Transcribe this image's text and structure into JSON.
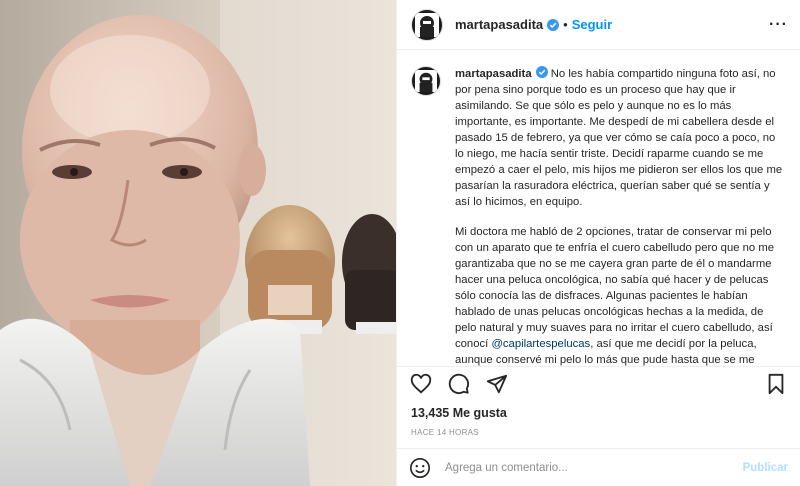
{
  "post": {
    "username": "martapasadita",
    "follow_label": "Seguir",
    "more_icon": "more-options-icon",
    "caption": {
      "p1": "No les había compartido ninguna foto así, no por pena sino porque todo es un proceso que hay que ir asimilando. Se que sólo es pelo y aunque no es lo más importante, es importante. Me despedí de mi cabellera desde el pasado 15 de febrero, ya que ver cómo se caía poco a poco, no lo niego, me hacía sentir triste. Decidí raparme cuando se me empezó a caer el pelo, mis hijos me pidieron ser ellos los que me pasarían la rasuradora eléctrica, querían saber qué se sentía y así lo hicimos, en equipo.",
      "p2_before": "Mi doctora me habló de 2 opciones, tratar de conservar mi pelo con un aparato que te enfría el cuero cabelludo pero que no me garantizaba que no se me cayera gran parte de él o mandarme hacer una peluca oncológica, no sabía qué hacer y de pelucas sólo conocía las de disfraces. Algunas pacientes le habían hablado de unas pelucas oncológicas hechas a la medida, de pelo natural y muy suaves para no irritar el cuero cabelludo, así conocí ",
      "mention": "@capilartespelucas",
      "p2_after": ", así que me decidí por la peluca, aunque conservé mi pelo lo más que pude hasta que se me empezó a caer, cuando comenzó la caída, en 3 días ya estaba prácticamente calva así que fuera pelo y a usar peluca."
    },
    "likes": "13,435 Me gusta",
    "time": "HACE 14 HORAS"
  },
  "comment": {
    "placeholder": "Agrega un comentario...",
    "publish_label": "Publicar"
  },
  "colors": {
    "accent": "#0095f6",
    "publish_disabled": "#b2dffc",
    "text": "#262626",
    "muted": "#8e8e8e",
    "mention": "#00376b"
  }
}
